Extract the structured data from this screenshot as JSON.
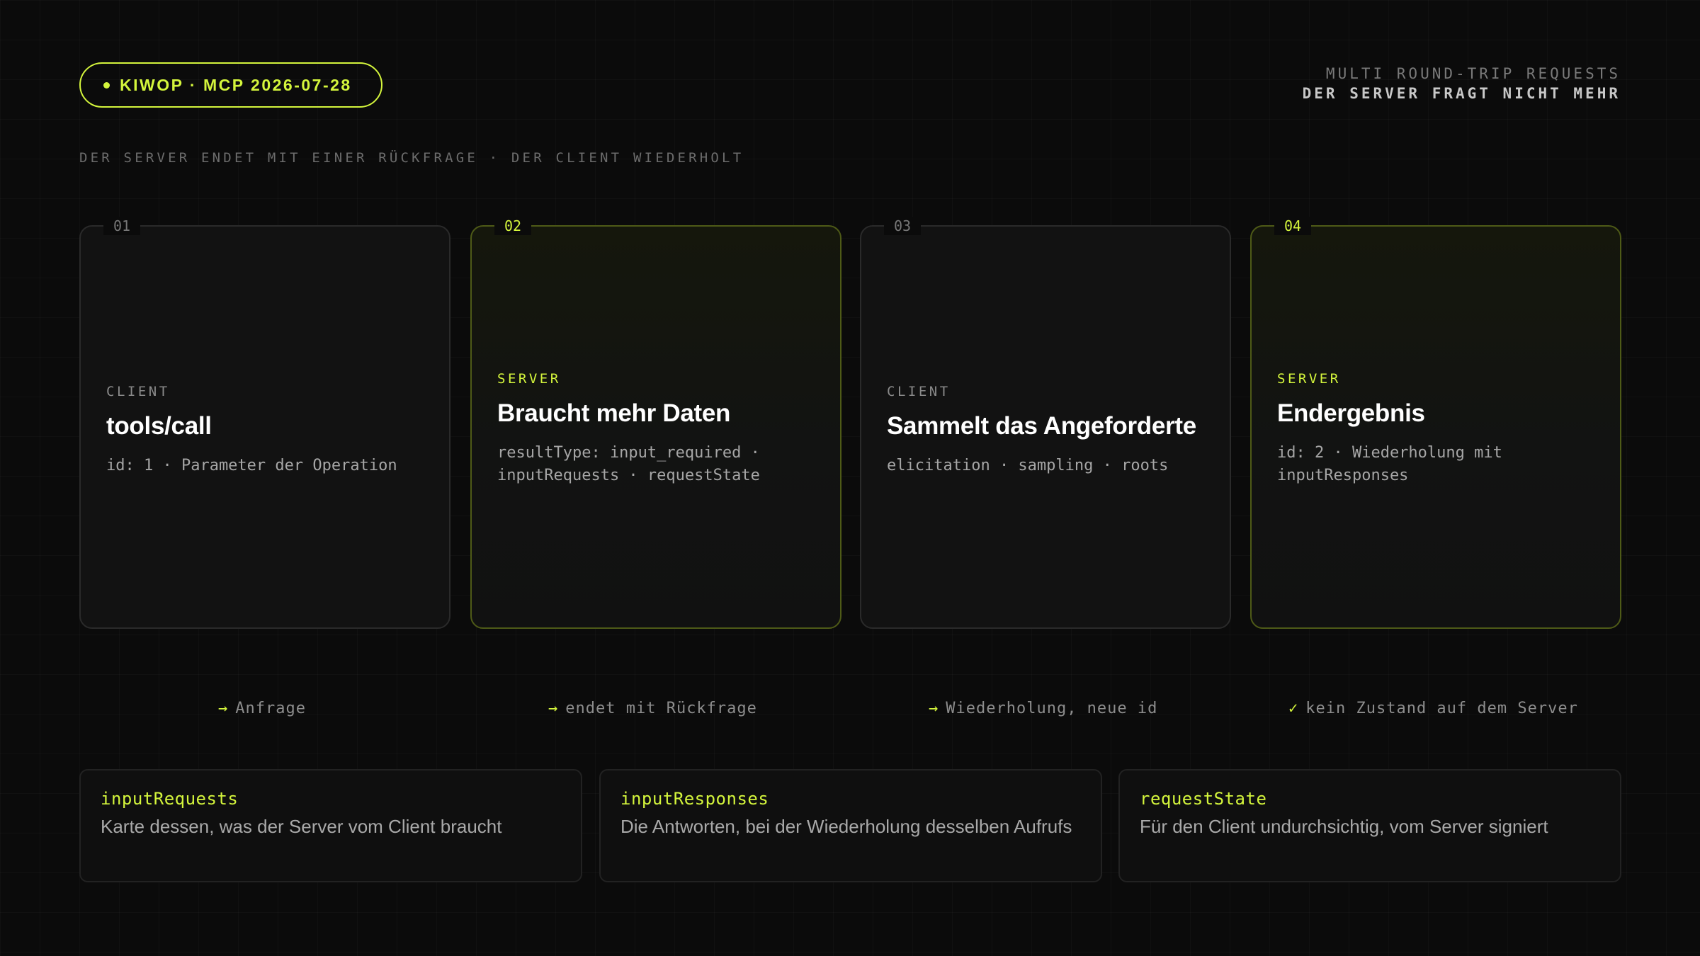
{
  "header": {
    "badge": "KIWOP · MCP 2026-07-28",
    "top_right_line1": "MULTI ROUND-TRIP REQUESTS",
    "top_right_line2": "DER SERVER FRAGT NICHT MEHR",
    "subtitle": "DER SERVER ENDET MIT EINER RÜCKFRAGE · DER CLIENT WIEDERHOLT"
  },
  "steps": [
    {
      "num": "01",
      "role": "CLIENT",
      "title": "tools/call",
      "desc": "id: 1 · Parameter der Operation",
      "highlighted": false
    },
    {
      "num": "02",
      "role": "SERVER",
      "title": "Braucht mehr Daten",
      "desc": "resultType: input_required · inputRequests · requestState",
      "highlighted": true
    },
    {
      "num": "03",
      "role": "CLIENT",
      "title": "Sammelt das Angeforderte",
      "desc": "elicitation · sampling · roots",
      "highlighted": false
    },
    {
      "num": "04",
      "role": "SERVER",
      "title": "Endergebnis",
      "desc": "id: 2 · Wiederholung mit inputResponses",
      "highlighted": true
    }
  ],
  "flow": [
    {
      "symbol": "→",
      "label": "Anfrage"
    },
    {
      "symbol": "→",
      "label": "endet mit Rückfrage"
    },
    {
      "symbol": "→",
      "label": "Wiederholung, neue id"
    },
    {
      "symbol": "✓",
      "label": "kein Zustand auf dem Server"
    }
  ],
  "glossary": [
    {
      "term": "inputRequests",
      "definition": "Karte dessen, was der Server vom Client braucht"
    },
    {
      "term": "inputResponses",
      "definition": "Die Antworten, bei der Wiederholung desselben Aufrufs"
    },
    {
      "term": "requestState",
      "definition": "Für den Client undurchsichtig, vom Server signiert"
    }
  ],
  "colors": {
    "accent": "#d4f53c",
    "background": "#0b0b0b"
  }
}
